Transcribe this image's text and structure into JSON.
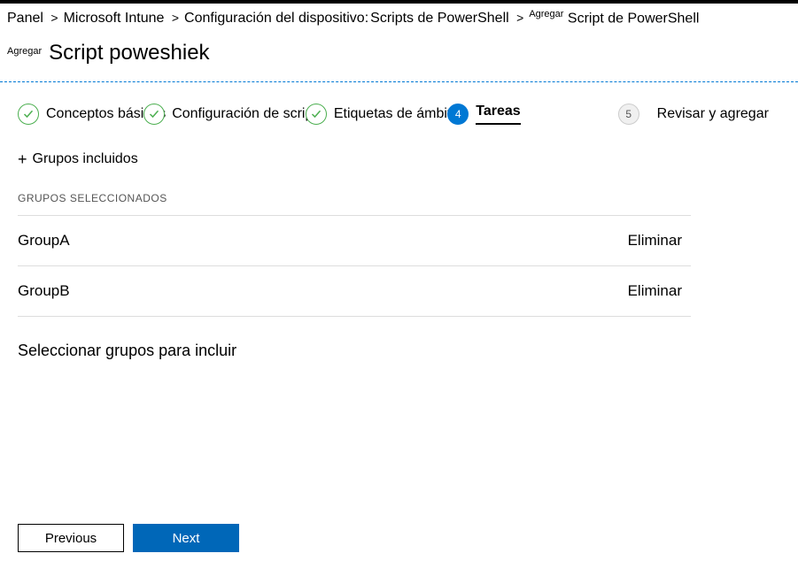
{
  "breadcrumb": {
    "items": [
      {
        "label": "Panel",
        "sep": "&gt;"
      },
      {
        "label": "Microsoft Intune",
        "sep": "&gt;"
      },
      {
        "label": "Configuración del dispositivo:",
        "sep": ""
      },
      {
        "label": "Scripts de PowerShell",
        "sep": "&gt;"
      },
      {
        "prefix": "Agregar",
        "label": "Script de PowerShell",
        "sep": ""
      }
    ]
  },
  "header": {
    "prefix": "Agregar",
    "title": "Script poweshiek"
  },
  "steps": {
    "s1": {
      "label": "Conceptos básicos"
    },
    "s2": {
      "label": "Configuración de script"
    },
    "s3": {
      "label": "Etiquetas de ámbito"
    },
    "s4": {
      "label": "Tareas",
      "num": "4"
    },
    "s5": {
      "label": "Revisar y agregar",
      "num": "5"
    }
  },
  "included": {
    "add_label": "Grupos incluidos",
    "section_label": "GRUPOS SELECCIONADOS"
  },
  "groups": [
    {
      "name": "GroupA",
      "remove": "Eliminar"
    },
    {
      "name": "GroupB",
      "remove": "Eliminar"
    }
  ],
  "select_groups_label": "Seleccionar grupos para incluir",
  "footer": {
    "previous": "Previous",
    "next": "Next"
  }
}
